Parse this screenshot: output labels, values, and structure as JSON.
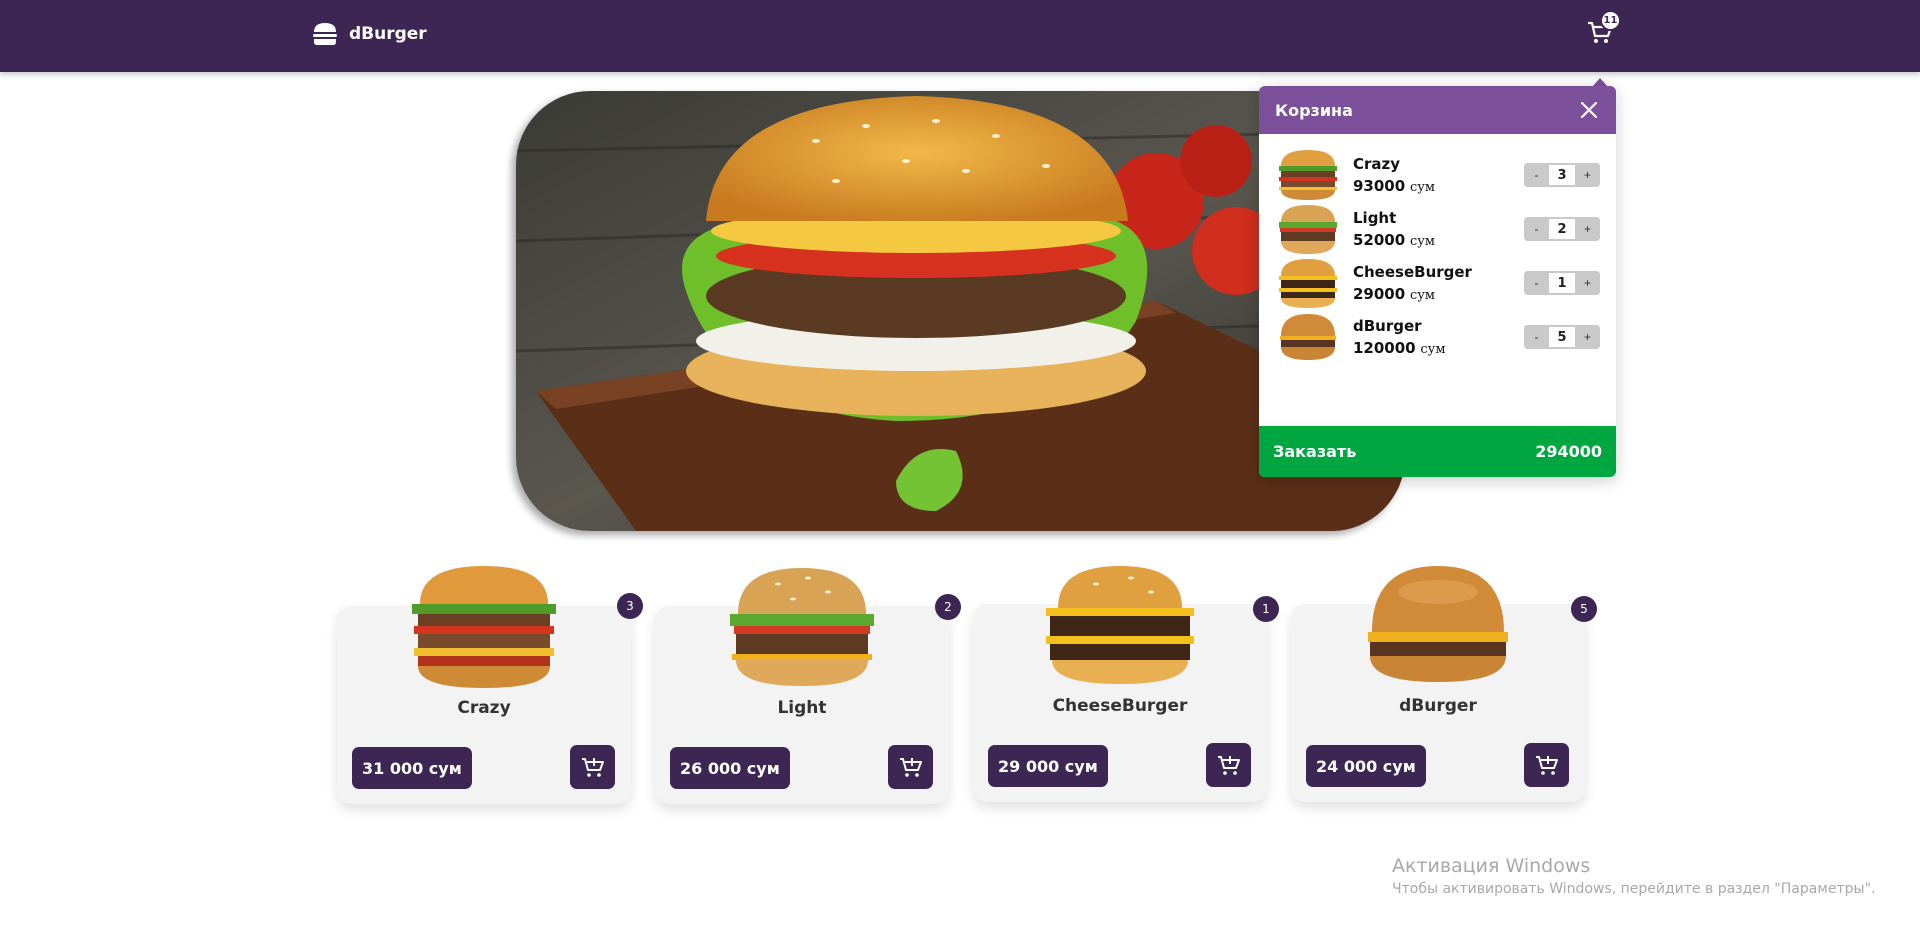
{
  "header": {
    "brand": "dBurger",
    "cart_count": "11"
  },
  "cart": {
    "title": "Корзина",
    "currency": "сум",
    "items": [
      {
        "name": "Crazy",
        "price": "93000",
        "qty": "3",
        "minus": "-",
        "plus": "+"
      },
      {
        "name": "Light",
        "price": "52000",
        "qty": "2",
        "minus": "-",
        "plus": "+"
      },
      {
        "name": "CheeseBurger",
        "price": "29000",
        "qty": "1",
        "minus": "-",
        "plus": "+"
      },
      {
        "name": "dBurger",
        "price": "120000",
        "qty": "5",
        "minus": "-",
        "plus": "+"
      }
    ],
    "order_label": "Заказать",
    "total": "294000"
  },
  "products": [
    {
      "name": "Crazy",
      "price": "31 000 сум",
      "badge": "3"
    },
    {
      "name": "Light",
      "price": "26 000 сум",
      "badge": "2"
    },
    {
      "name": "CheeseBurger",
      "price": "29 000 сум",
      "badge": "1"
    },
    {
      "name": "dBurger",
      "price": "24 000 сум",
      "badge": "5"
    }
  ],
  "watermark": {
    "title": "Активация Windows",
    "subtitle": "Чтобы активировать Windows, перейдите в раздел \"Параметры\"."
  },
  "colors": {
    "brand_purple": "#3d2653",
    "cart_header": "#7b4f9a",
    "order_green": "#00a640"
  }
}
